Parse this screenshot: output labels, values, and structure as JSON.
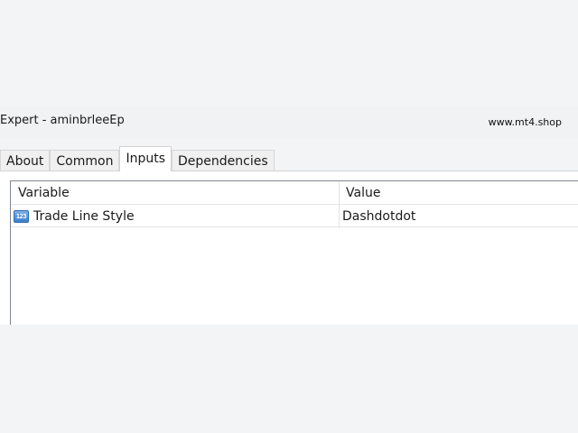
{
  "window": {
    "title": "Expert - aminbrleeEp",
    "watermark": "www.mt4.shop"
  },
  "tabs": [
    {
      "label": "About",
      "active": false
    },
    {
      "label": "Common",
      "active": false
    },
    {
      "label": "Inputs",
      "active": true
    },
    {
      "label": "Dependencies",
      "active": false
    }
  ],
  "grid": {
    "columns": [
      "Variable",
      "Value"
    ],
    "rows": [
      {
        "icon": "numeric-parameter-icon",
        "icon_text": "123",
        "variable": "Trade Line Style",
        "value": "Dashdotdot"
      }
    ]
  },
  "colors": {
    "background": "#f3f4f6",
    "panel": "#ffffff",
    "icon_blue": "#3e7fcb"
  }
}
